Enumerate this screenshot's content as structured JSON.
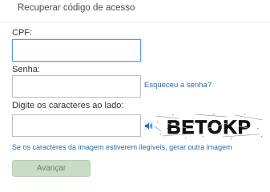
{
  "header": {
    "title": "Recuperar código de acesso"
  },
  "form": {
    "cpf": {
      "label": "CPF:",
      "value": ""
    },
    "senha": {
      "label": "Senha:",
      "value": "",
      "forgot_link": "Esqueceu a senha?"
    },
    "captcha": {
      "label": "Digite os caracteres ao lado:",
      "value": "",
      "image_text": "BETOKP",
      "audio_icon": "speaker-icon",
      "help_text": "Se os caracteres da imagem estiverem ilegíveis, ",
      "help_link": "gerar outra imagem"
    },
    "submit_label": "Avançar"
  },
  "colors": {
    "link": "#2b6aa6",
    "button_bg": "#c9dcc6",
    "button_text": "#6f7f6c",
    "focus_border": "#5b9bd5"
  }
}
